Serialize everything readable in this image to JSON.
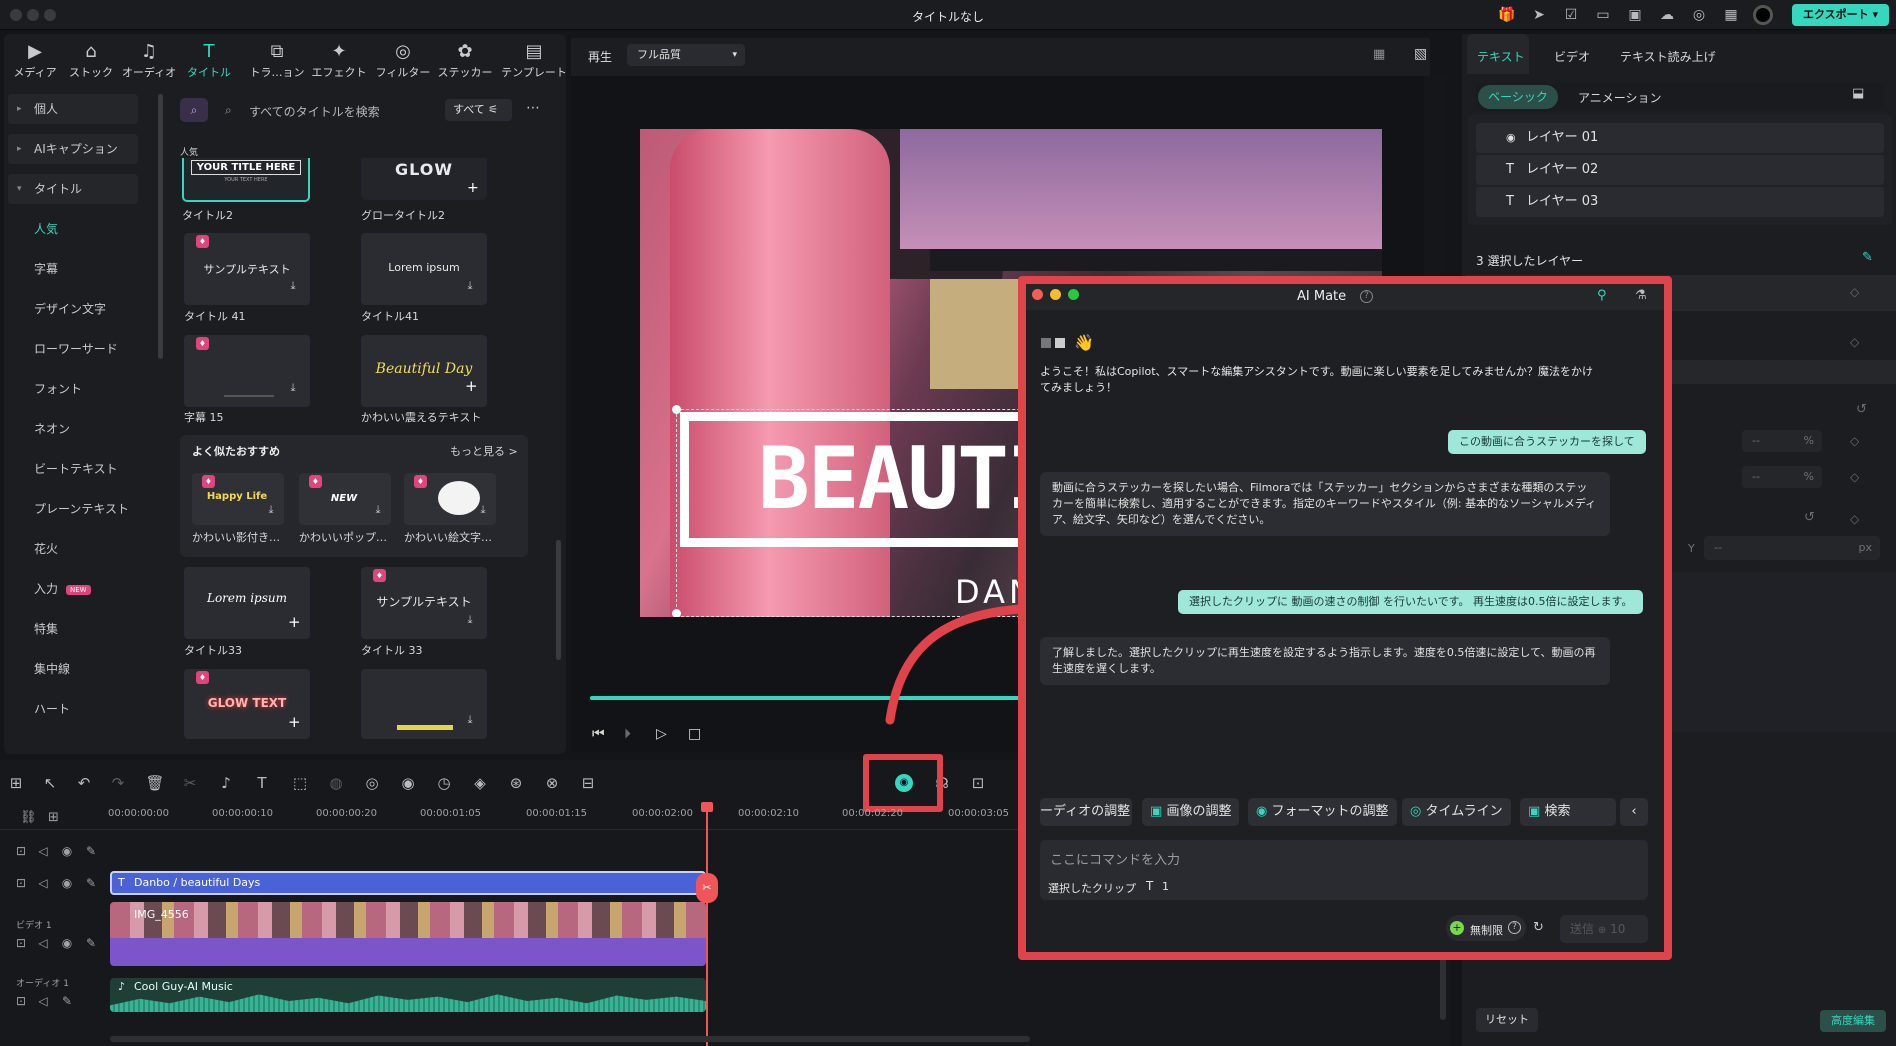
{
  "app": {
    "title": "タイトルなし",
    "export_label": "エクスポート"
  },
  "top_tabs": [
    {
      "label": "メディア",
      "icon": "media-icon"
    },
    {
      "label": "ストック",
      "icon": "stock-icon"
    },
    {
      "label": "オーディオ",
      "icon": "audio-icon"
    },
    {
      "label": "タイトル",
      "icon": "title-icon"
    },
    {
      "label": "トラ…ョン",
      "icon": "transition-icon"
    },
    {
      "label": "エフェクト",
      "icon": "effect-icon"
    },
    {
      "label": "フィルター",
      "icon": "filter-icon"
    },
    {
      "label": "ステッカー",
      "icon": "sticker-icon"
    },
    {
      "label": "テンプレート",
      "icon": "template-icon"
    }
  ],
  "sidebar": {
    "items": [
      {
        "label": "個人"
      },
      {
        "label": "AIキャプション"
      },
      {
        "label": "タイトル"
      },
      {
        "label": "人気"
      },
      {
        "label": "字幕"
      },
      {
        "label": "デザイン文字"
      },
      {
        "label": "ローワーサード"
      },
      {
        "label": "フォント"
      },
      {
        "label": "ネオン"
      },
      {
        "label": "ビートテキスト"
      },
      {
        "label": "プレーンテキスト"
      },
      {
        "label": "花火"
      },
      {
        "label": "入力",
        "badge": "NEW"
      },
      {
        "label": "特集"
      },
      {
        "label": "集中線"
      },
      {
        "label": "ハート"
      }
    ]
  },
  "browser": {
    "search_placeholder": "すべてのタイトルを検索",
    "filter_label": "すべて",
    "section_popular": "人気",
    "tiles": [
      {
        "label": "タイトル2",
        "preview": "YOUR TITLE HERE",
        "sub": "YOUR TEXT HERE"
      },
      {
        "label": "グロータイトル2",
        "preview": "GLOW"
      },
      {
        "label": "タイトル 41",
        "preview": "サンプルテキスト"
      },
      {
        "label": "タイトル41",
        "preview": "Lorem ipsum"
      },
      {
        "label": "字幕 15",
        "preview": ""
      },
      {
        "label": "かわいい震えるテキスト",
        "preview": "Beautiful Day"
      },
      {
        "label": "タイトル33",
        "preview": "Lorem ipsum"
      },
      {
        "label": "タイトル 33",
        "preview": "サンプルテキスト"
      },
      {
        "label": "",
        "preview": "GLOW TEXT"
      },
      {
        "label": "",
        "preview": ""
      }
    ],
    "recommend": {
      "title": "よく似たおすすめ",
      "more": "もっと見る >",
      "items": [
        {
          "label": "かわいい影付き…",
          "preview": "Happy Life"
        },
        {
          "label": "かわいいポップ…",
          "preview": "NEW"
        },
        {
          "label": "かわいい絵文字…",
          "preview": ""
        }
      ]
    }
  },
  "player": {
    "play_label": "再生",
    "quality": "フル品質",
    "overlay_text": "BEAUTIF",
    "overlay_sub": "DAN"
  },
  "ai_mate": {
    "title": "AI Mate",
    "greeting_wave": "👋",
    "welcome": "ようこそ！私はCopilot、スマートな編集アシスタントです。動画に楽しい要素を足してみませんか？魔法をかけてみましょう！",
    "user_msg_1": "この動画に合うステッカーを探して",
    "ai_msg_1": "動画に合うステッカーを探したい場合、Filmoraでは「ステッカー」セクションからさまざまな種類のステッカーを簡単に検索し、適用することができます。指定のキーワードやスタイル（例: 基本的なソーシャルメディア、絵文字、矢印など）を選んでください。",
    "user_msg_2": "選択したクリップに 動画の速さの制御 を行いたいです。 再生速度は0.5倍に設定します。",
    "ai_msg_2": "了解しました。選択したクリップに再生速度を設定するよう指示します。速度を0.5倍速に設定して、動画の再生速度を遅くします。",
    "chips": [
      "ーディオの調整",
      "画像の調整",
      "フォーマットの調整",
      "タイムライン",
      "検索"
    ],
    "input_placeholder": "ここにコマンドを入力",
    "selected_clip_label": "選択したクリップ",
    "selected_clip_count": "1",
    "unlimited_label": "無制限",
    "send_label": "送信",
    "send_cost": "10"
  },
  "right_panel": {
    "tabs": [
      "テキスト",
      "ビデオ",
      "テキスト読み上げ"
    ],
    "subtabs": [
      "ベーシック",
      "アニメーション"
    ],
    "layers": [
      "レイヤー 01",
      "レイヤー 02",
      "レイヤー 03"
    ],
    "selected_layers": "3 選択したレイヤー",
    "pct_1": "--",
    "pct_2": "--",
    "pct_unit": "%",
    "y_label": "Y",
    "y_value": "--",
    "y_unit": "px",
    "reset_label": "リセット",
    "advanced_label": "高度編集"
  },
  "timeline": {
    "ruler": [
      "00:00:00:00",
      "00:00:00:10",
      "00:00:00:20",
      "00:00:01:05",
      "00:00:01:15",
      "00:00:02:00",
      "00:00:02:10",
      "00:00:02:20",
      "00:00:03:05"
    ],
    "title_clip": "Danbo / beautiful Days",
    "video_clip": "IMG_4556",
    "audio_clip": "Cool Guy-AI Music",
    "video_track": "ビデオ 1",
    "audio_track": "オーディオ 1"
  },
  "colors": {
    "accent": "#35d7be",
    "highlight": "#e0434a",
    "title_clip": "#4a62d8",
    "video_clip": "#7b55c9",
    "audio_wave": "#36b594"
  }
}
